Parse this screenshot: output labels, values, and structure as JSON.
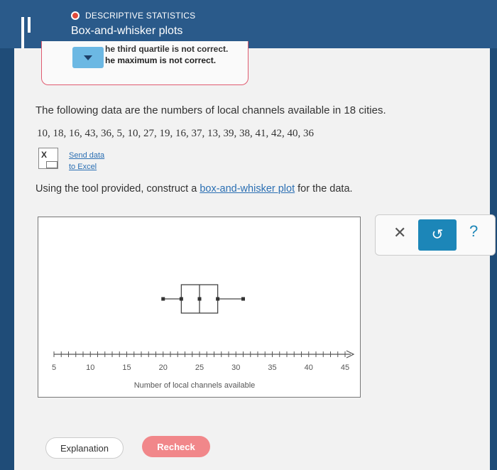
{
  "header": {
    "topic": "DESCRIPTIVE STATISTICS",
    "title": "Box-and-whisker plots",
    "accent": "#2a5a8a"
  },
  "feedback": {
    "line1": "he third quartile is not correct.",
    "line2": "he maximum is not correct."
  },
  "question": {
    "prompt": "The following data are the numbers of local channels available in 18 cities.",
    "data_text": "10, 18, 16, 43, 36, 5, 10, 27, 19, 16, 37, 13, 39, 38, 41, 42, 40, 36",
    "send_data_line1": "Send data",
    "send_data_line2": "to Excel",
    "instruction_before": "Using the tool provided, construct a ",
    "instruction_link": "box-and-whisker plot",
    "instruction_after": " for the data."
  },
  "chart_data": {
    "type": "box",
    "xlabel": "Number of local channels available",
    "xlim": [
      5,
      45
    ],
    "tick_labels": [
      "5",
      "10",
      "15",
      "20",
      "25",
      "30",
      "35",
      "40",
      "45"
    ],
    "tick_values": [
      5,
      10,
      15,
      20,
      25,
      30,
      35,
      40,
      45
    ],
    "box": {
      "min": 20,
      "q1": 22.5,
      "median": 25,
      "q3": 27.5,
      "max": 31
    }
  },
  "tools": {
    "clear_icon": "close-icon",
    "undo_icon": "undo-icon",
    "help_icon": "help-icon",
    "clear_glyph": "✕",
    "undo_glyph": "↺",
    "help_glyph": "?"
  },
  "footer": {
    "explanation_label": "Explanation",
    "recheck_label": "Recheck"
  }
}
